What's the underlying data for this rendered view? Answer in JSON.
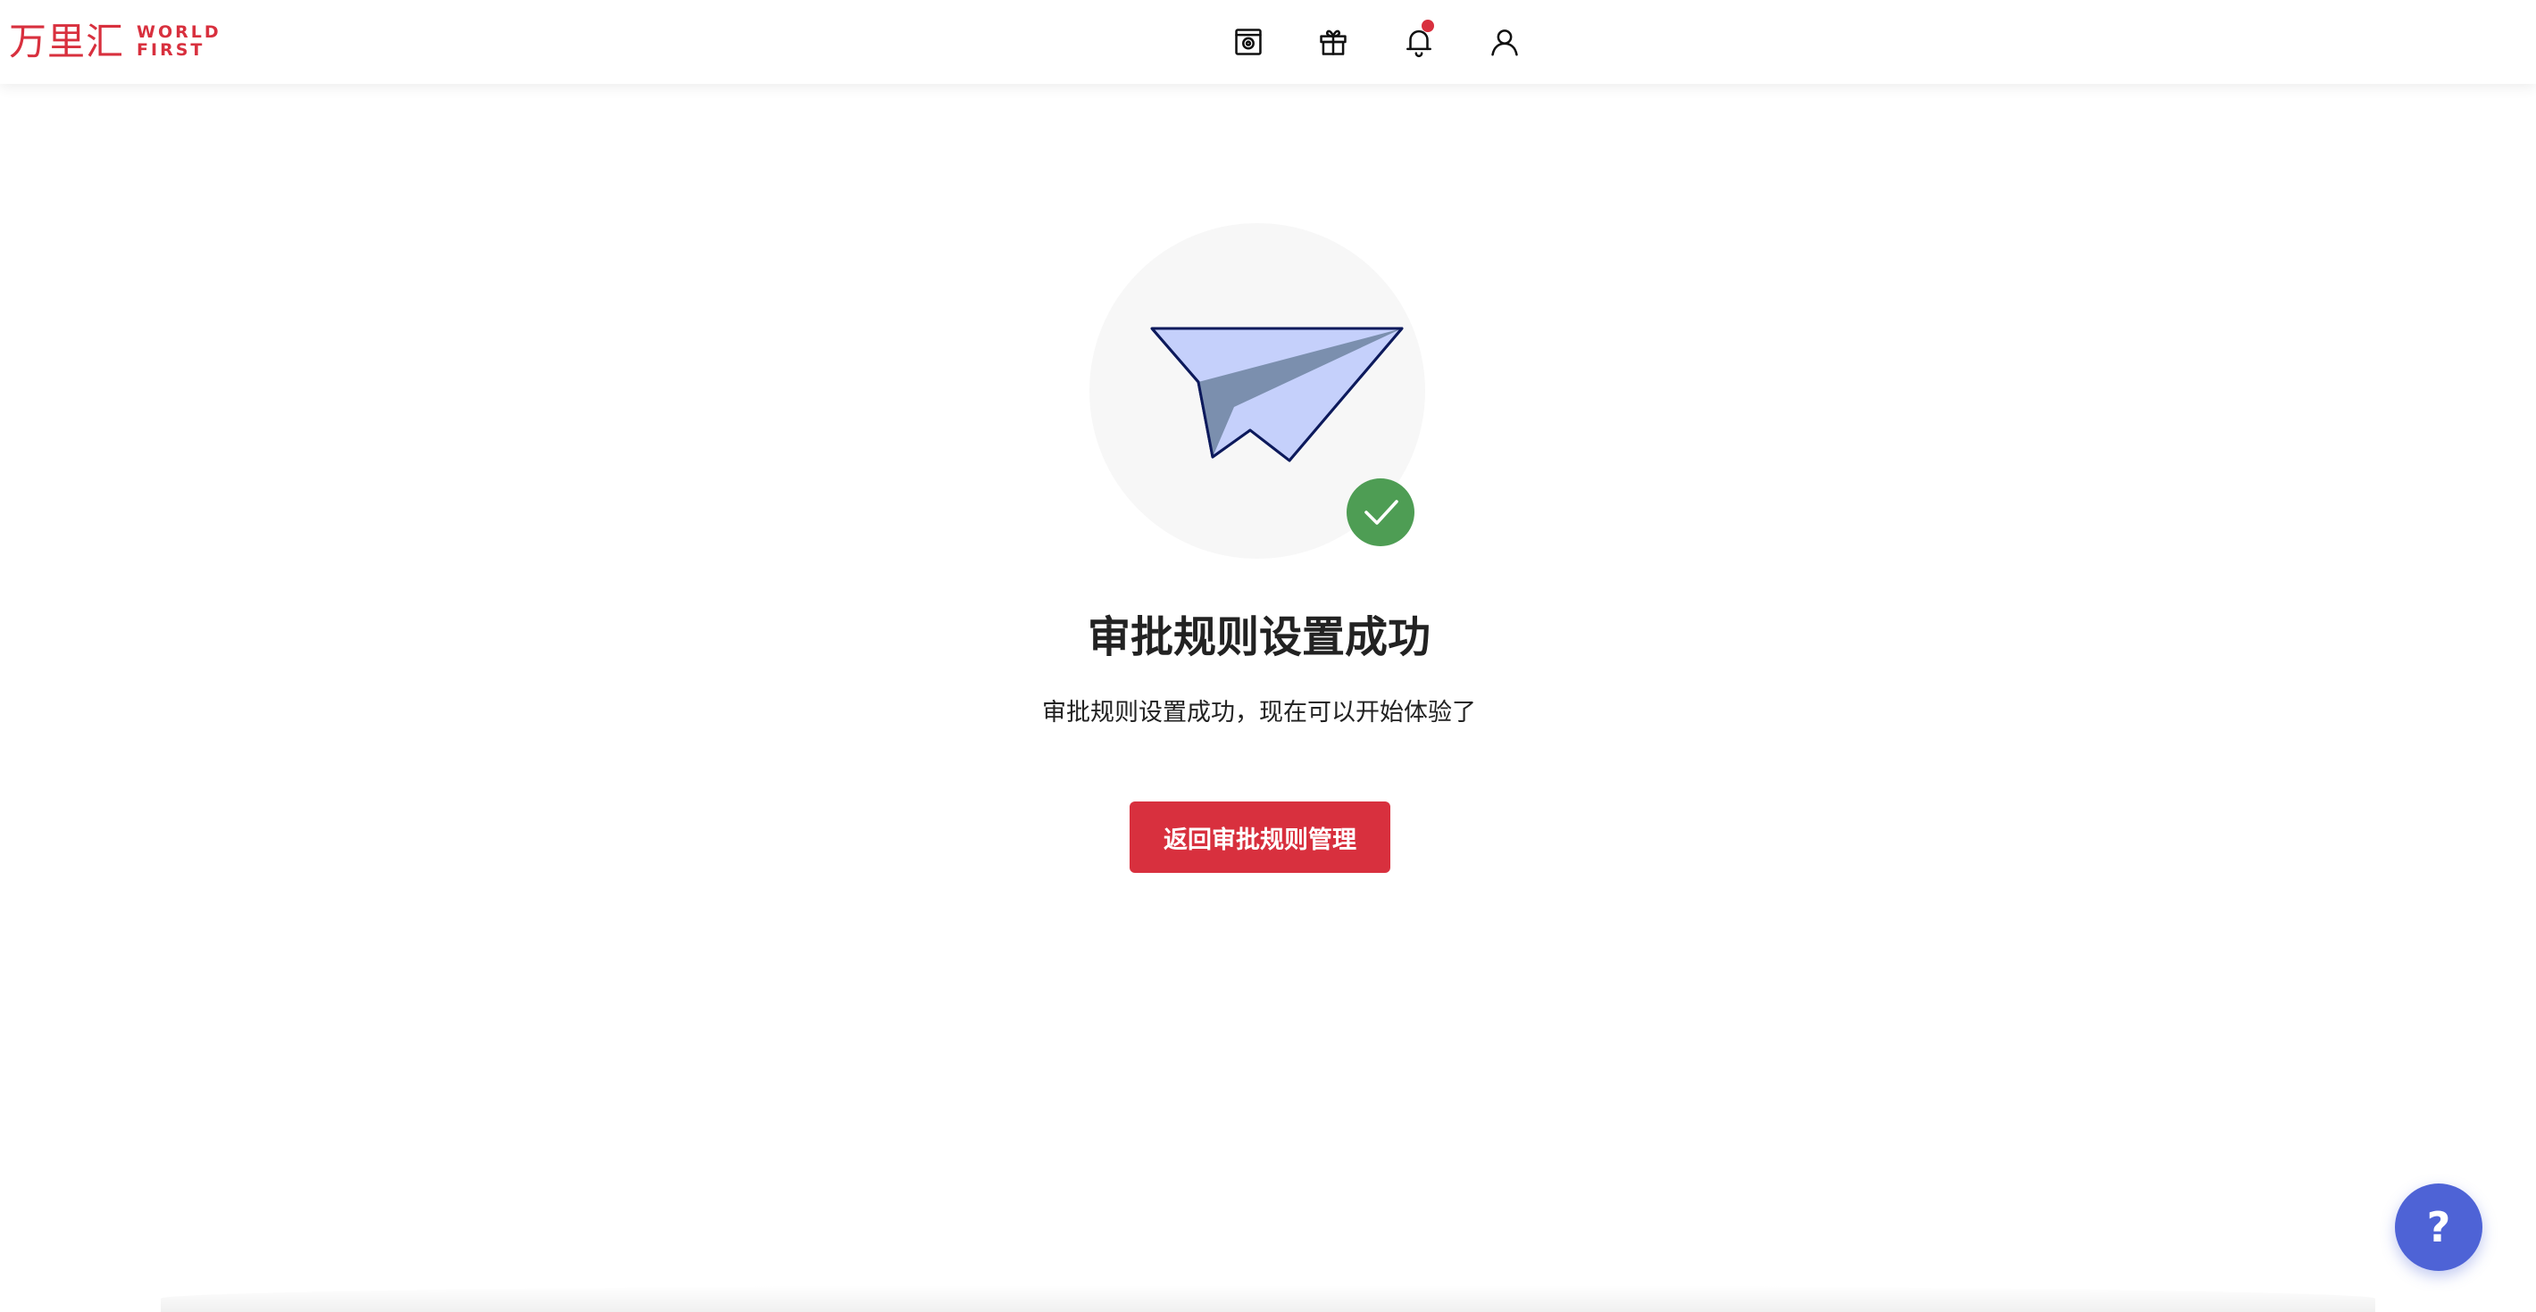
{
  "header": {
    "logo_cn": "万里汇",
    "logo_en_line1": "WORLD",
    "logo_en_line2": "FIRST",
    "icons": [
      "camera-box-icon",
      "gift-icon",
      "bell-icon",
      "user-icon"
    ],
    "has_notification": true
  },
  "result": {
    "title": "审批规则设置成功",
    "message": "审批规则设置成功，现在可以开始体验了",
    "button_label": "返回审批规则管理"
  },
  "help": {
    "label": "?"
  },
  "colors": {
    "brand_red": "#d8303e",
    "success_green": "#4e9d54",
    "help_blue": "#4e63d6",
    "plane_light": "#c5d0fb",
    "plane_dark": "#7b8fae"
  }
}
